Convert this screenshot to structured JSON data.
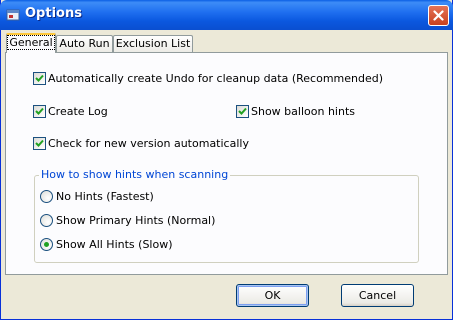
{
  "window": {
    "title": "Options",
    "icon": "app-options-icon"
  },
  "tabs": [
    {
      "label": "General",
      "active": true
    },
    {
      "label": "Auto Run",
      "active": false
    },
    {
      "label": "Exclusion List",
      "active": false
    }
  ],
  "general": {
    "undo_label": "Automatically create Undo for cleanup data (Recommended)",
    "undo_checked": true,
    "log_label": "Create Log",
    "log_checked": true,
    "balloon_label": "Show balloon hints",
    "balloon_checked": true,
    "version_label": "Check for new version automatically",
    "version_checked": true
  },
  "hints_group": {
    "title": "How to show hints when scanning",
    "options": [
      {
        "label": "No Hints (Fastest)",
        "selected": false
      },
      {
        "label": "Show Primary Hints (Normal)",
        "selected": false
      },
      {
        "label": "Show All Hints (Slow)",
        "selected": true
      }
    ]
  },
  "buttons": {
    "ok": "OK",
    "cancel": "Cancel"
  },
  "colors": {
    "titlebar": "#0b58df",
    "group_title": "#0046d5",
    "radio_dot": "#21a121",
    "check": "#21a121"
  }
}
